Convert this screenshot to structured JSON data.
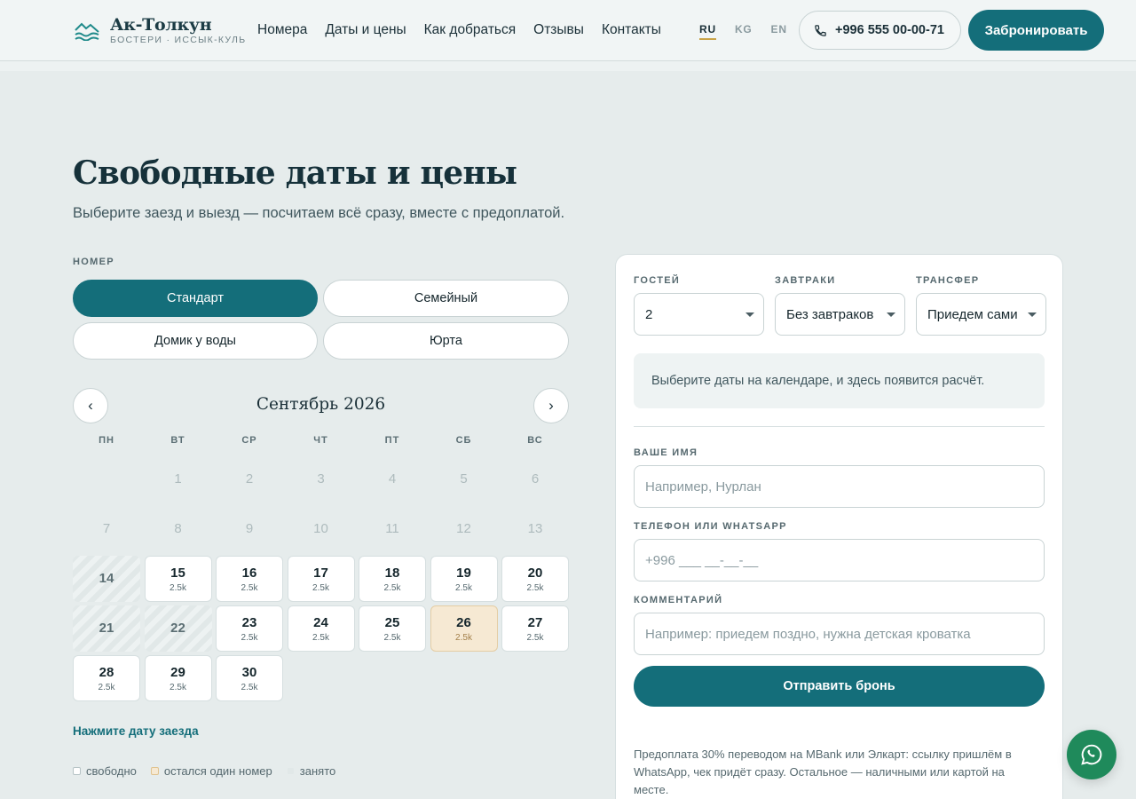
{
  "brand": {
    "name": "Ак-Толкун",
    "tagline": "БОСТЕРИ · ИССЫК-КУЛЬ"
  },
  "nav": [
    "Номера",
    "Даты и цены",
    "Как добраться",
    "Отзывы",
    "Контакты"
  ],
  "langs": [
    {
      "code": "RU",
      "active": true
    },
    {
      "code": "KG",
      "active": false
    },
    {
      "code": "EN",
      "active": false
    }
  ],
  "phone": "+996 555 00-00-71",
  "book_label": "Забронировать",
  "page": {
    "title": "Свободные даты и цены",
    "subtitle": "Выберите заезд и выезд — посчитаем всё сразу, вместе с предоплатой."
  },
  "rooms": {
    "label": "НОМЕР",
    "items": [
      {
        "label": "Стандарт",
        "active": true
      },
      {
        "label": "Семейный",
        "active": false
      },
      {
        "label": "Домик у воды",
        "active": false
      },
      {
        "label": "Юрта",
        "active": false
      }
    ]
  },
  "calendar": {
    "month": "Сентябрь 2026",
    "prev": "‹",
    "next": "›",
    "weekdays": [
      "ПН",
      "ВТ",
      "СР",
      "ЧТ",
      "ПТ",
      "СБ",
      "ВС"
    ],
    "days": [
      {
        "day": "",
        "status": "empty"
      },
      {
        "day": "1",
        "status": "past"
      },
      {
        "day": "2",
        "status": "past"
      },
      {
        "day": "3",
        "status": "past"
      },
      {
        "day": "4",
        "status": "past"
      },
      {
        "day": "5",
        "status": "past"
      },
      {
        "day": "6",
        "status": "past"
      },
      {
        "day": "7",
        "status": "past"
      },
      {
        "day": "8",
        "status": "past"
      },
      {
        "day": "9",
        "status": "past"
      },
      {
        "day": "10",
        "status": "past"
      },
      {
        "day": "11",
        "status": "past"
      },
      {
        "day": "12",
        "status": "past"
      },
      {
        "day": "13",
        "status": "past"
      },
      {
        "day": "14",
        "status": "busy"
      },
      {
        "day": "15",
        "status": "free",
        "price": "2.5k"
      },
      {
        "day": "16",
        "status": "free",
        "price": "2.5k"
      },
      {
        "day": "17",
        "status": "free",
        "price": "2.5k"
      },
      {
        "day": "18",
        "status": "free",
        "price": "2.5k"
      },
      {
        "day": "19",
        "status": "free",
        "price": "2.5k"
      },
      {
        "day": "20",
        "status": "free",
        "price": "2.5k"
      },
      {
        "day": "21",
        "status": "busy"
      },
      {
        "day": "22",
        "status": "busy"
      },
      {
        "day": "23",
        "status": "free",
        "price": "2.5k"
      },
      {
        "day": "24",
        "status": "free",
        "price": "2.5k"
      },
      {
        "day": "25",
        "status": "free",
        "price": "2.5k"
      },
      {
        "day": "26",
        "status": "last",
        "price": "2.5k"
      },
      {
        "day": "27",
        "status": "free",
        "price": "2.5k"
      },
      {
        "day": "28",
        "status": "free",
        "price": "2.5k"
      },
      {
        "day": "29",
        "status": "free",
        "price": "2.5k"
      },
      {
        "day": "30",
        "status": "free",
        "price": "2.5k"
      }
    ],
    "hint": "Нажмите дату заезда",
    "legend": [
      {
        "label": "свободно",
        "kind": "free"
      },
      {
        "label": "остался один номер",
        "kind": "last"
      },
      {
        "label": "занято",
        "kind": "busy"
      }
    ]
  },
  "booking": {
    "guests": {
      "label": "ГОСТЕЙ",
      "value": "2"
    },
    "breakfast": {
      "label": "ЗАВТРАКИ",
      "value": "Без завтраков"
    },
    "transfer": {
      "label": "ТРАНСФЕР",
      "value": "Приедем сами"
    },
    "calc_text": "Выберите даты на календаре, и здесь появится расчёт.",
    "name": {
      "label": "ВАШЕ ИМЯ",
      "placeholder": "Например, Нурлан"
    },
    "phone": {
      "label": "ТЕЛЕФОН ИЛИ WHATSAPP",
      "placeholder": "+996 ___ __-__-__"
    },
    "comment": {
      "label": "КОММЕНТАРИЙ",
      "placeholder": "Например: приедем поздно, нужна детская кроватка"
    },
    "submit": "Отправить бронь",
    "note": "Предоплата 30% переводом на MBank или Элкарт: ссылку пришлём в WhatsApp, чек придёт сразу. Остальное — наличными или картой на месте."
  }
}
